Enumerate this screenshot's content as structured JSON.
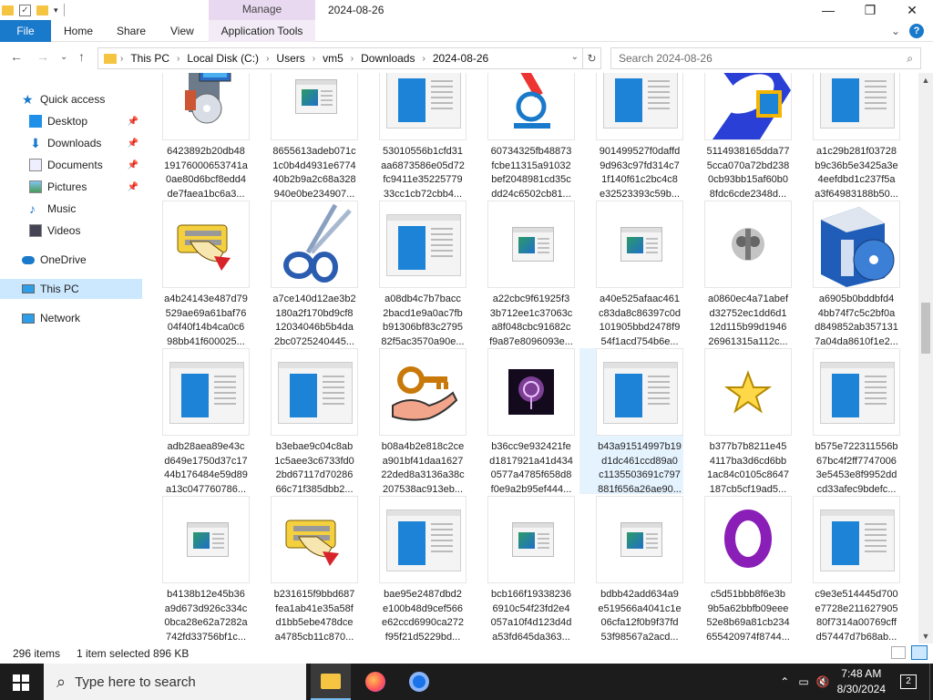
{
  "title_bar": {
    "manage_tab": "Manage",
    "path_title": "2024-08-26",
    "minimize": "—",
    "maximize": "❐",
    "close": "✕"
  },
  "ribbon": {
    "file": "File",
    "home": "Home",
    "share": "Share",
    "view": "View",
    "app_tools": "Application Tools"
  },
  "address": {
    "crumbs": [
      "This PC",
      "Local Disk (C:)",
      "Users",
      "vm5",
      "Downloads",
      "2024-08-26"
    ]
  },
  "search": {
    "placeholder": "Search 2024-08-26"
  },
  "nav": {
    "quick_access": "Quick access",
    "desktop": "Desktop",
    "downloads": "Downloads",
    "documents": "Documents",
    "pictures": "Pictures",
    "music": "Music",
    "videos": "Videos",
    "onedrive": "OneDrive",
    "this_pc": "This PC",
    "network": "Network"
  },
  "files": [
    {
      "name": "6423892b20db48\n19176000653741a\n0ae80d6bcf8edd4\nde7faea1bc6a3...",
      "icon": "installer-icon"
    },
    {
      "name": "8655613adeb071c\n1c0b4d4931e6774\n40b2b9a2c68a328\n940e0be234907...",
      "icon": "app-window-small-icon"
    },
    {
      "name": "53010556b1cfd31\naa6873586e05d72\nfc9411e35225779\n33cc1cb72cbb4...",
      "icon": "app-window-icon"
    },
    {
      "name": "60734325fb48873\nfcbe11315a91032\nbef2048981cd35c\ndd24c6502cb81...",
      "icon": "microscope-icon"
    },
    {
      "name": "901499527f0daffd\n9d963c97fd314c7\n1f140f61c2bc4c8\ne32523393c59b...",
      "icon": "app-window-icon"
    },
    {
      "name": "5114938165dda77\n5cca070a72bd238\n0cb93bb15af60b0\n8fdc6cde2348d...",
      "icon": "blue-logo-icon"
    },
    {
      "name": "a1c29b281f03728\nb9c36b5e3425a3e\n4eefdbd1c237f5a\na3f64983188b50...",
      "icon": "app-window-icon"
    },
    {
      "name": "a4b24143e487d79\n529ae69a61baf76\n04f40f14b4ca0c6\n98bb41f600025...",
      "icon": "hand-keyboard-icon"
    },
    {
      "name": "a7ce140d12ae3b2\n180a2f170bd9cf8\n12034046b5b4da\n2bc0725240445...",
      "icon": "scissors-icon"
    },
    {
      "name": "a08db4c7b7bacc\n2bacd1e9a0ac7fb\nb91306bf83c2795\n82f5ac3570a90e...",
      "icon": "app-window-icon"
    },
    {
      "name": "a22cbc9f61925f3\n3b712ee1c37063c\na8f048cbc91682c\nf9a87e8096093e...",
      "icon": "app-window-small-icon"
    },
    {
      "name": "a40e525afaac461\nc83da8c86397c0d\n101905bbd2478f9\n54f1acd754b6e...",
      "icon": "app-window-small-icon"
    },
    {
      "name": "a0860ec4a71abef\nd32752ec1dd6d1\n12d115b99d1946\n26961315a112c...",
      "icon": "gray-blob-icon"
    },
    {
      "name": "a6905b0bddbfd4\n4bb74f7c5c2bf0a\nd849852ab357131\n7a04da8610f1e2...",
      "icon": "cd-case-icon"
    },
    {
      "name": "adb28aea89e43c\nd649e1750d37c17\n44b176484e59d89\na13c047760786...",
      "icon": "app-window-icon"
    },
    {
      "name": "b3ebae9c04c8ab\n1c5aee3c6733fd0\n2bd67117d70286\n66c71f385dbb2...",
      "icon": "app-window-icon"
    },
    {
      "name": "b08a4b2e818c2ce\na901bf41daa1627\n22ded8a3136a38c\n207538ac913eb...",
      "icon": "key-hand-icon"
    },
    {
      "name": "b36cc9e932421fe\nd1817921a41d434\n0577a4785f658d8\nf0e9a2b95ef444...",
      "icon": "purple-glow-icon"
    },
    {
      "name": "b43a91514997b19\nd1dc461ccd89a0\nc1135503691c797\n881f656a26ae90...",
      "icon": "app-window-icon"
    },
    {
      "name": "b377b7b8211e45\n4117ba3d6cd6bb\n1ac84c0105c8647\n187cb5cf19ad5...",
      "icon": "star-icon"
    },
    {
      "name": "b575e722311556b\n67bc4f2ff7747006\n3e5453e8f9952dd\ncd33afec9bdefc...",
      "icon": "app-window-icon"
    },
    {
      "name": "b4138b12e45b36\na9d673d926c334c\n0bca28e62a7282a\n742fd33756bf1c...",
      "icon": "app-window-small-icon"
    },
    {
      "name": "b231615f9bbd687\nfea1ab41e35a58f\nd1bb5ebe478dce\na4785cb11c870...",
      "icon": "hand-keyboard-icon"
    },
    {
      "name": "bae95e2487dbd2\ne100b48d9cef566\ne62ccd6990ca272\nf95f21d5229bd...",
      "icon": "app-window-icon"
    },
    {
      "name": "bcb166f19338236\n6910c54f23fd2e4\n057a10f4d123d4d\na53fd645da363...",
      "icon": "app-window-small-icon"
    },
    {
      "name": "bdbb42add634a9\ne519566a4041c1e\n06cfa12f0b9f37fd\n53f98567a2acd...",
      "icon": "app-window-small-icon"
    },
    {
      "name": "c5d51bbb8f6e3b\n9b5a62bbfb09eee\n52e8b69a81cb234\n655420974f8744...",
      "icon": "opera-o-icon"
    },
    {
      "name": "c9e3e514445d700\ne7728e211627905\n80f7314a00769cff\nd57447d7b68ab...",
      "icon": "app-window-icon"
    }
  ],
  "status": {
    "count": "296 items",
    "selected": "1 item selected  896 KB"
  },
  "taskbar": {
    "search": "Type here to search",
    "time": "7:48 AM",
    "date": "8/30/2024",
    "notif": "2"
  }
}
